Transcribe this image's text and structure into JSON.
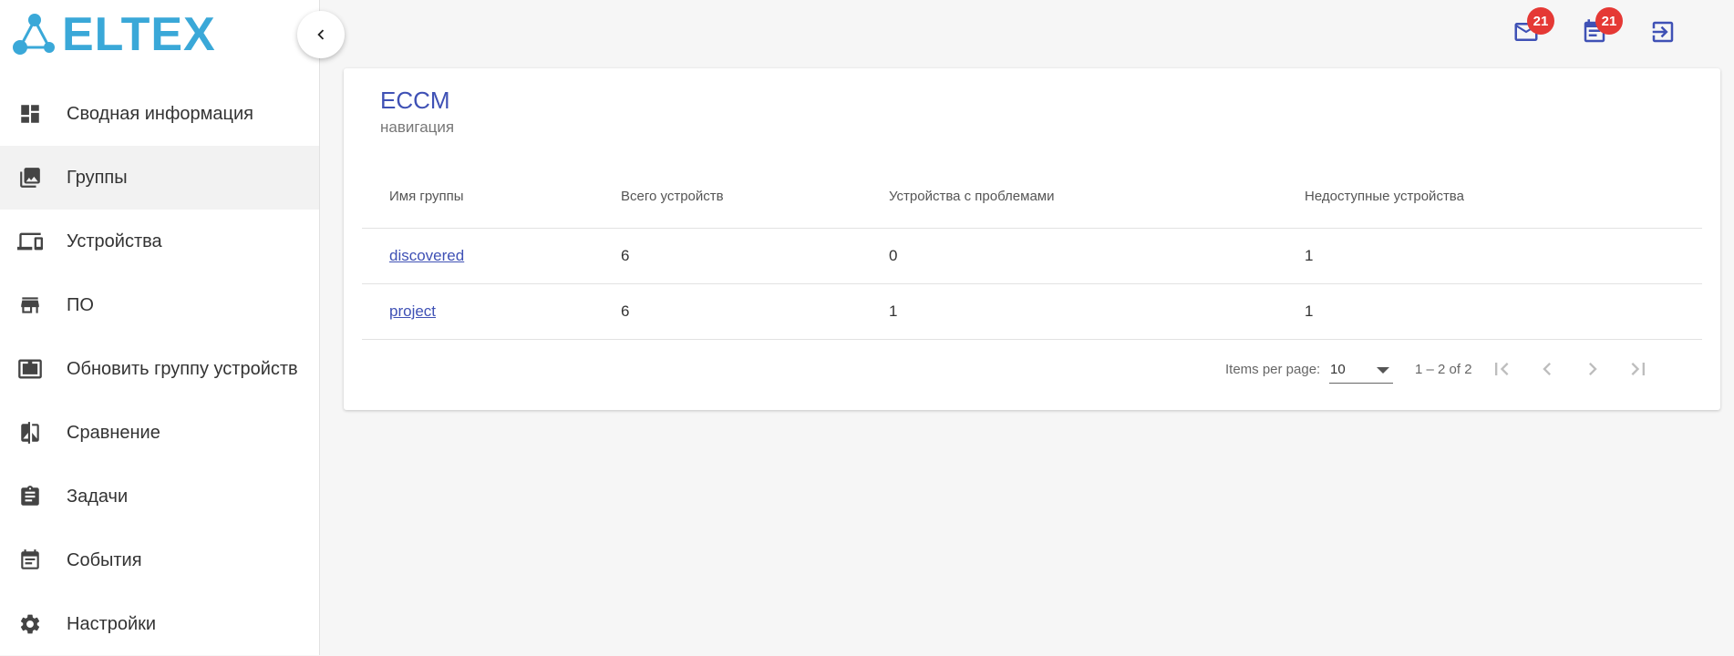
{
  "brand": {
    "logo_text": "ELTEX",
    "color": "#3aa8d8"
  },
  "sidebar": {
    "items": [
      {
        "label": "Сводная информация",
        "icon": "dashboard-icon",
        "active": false
      },
      {
        "label": "Группы",
        "icon": "photo-library-icon",
        "active": true
      },
      {
        "label": "Устройства",
        "icon": "devices-icon",
        "active": false
      },
      {
        "label": "ПО",
        "icon": "store-icon",
        "active": false
      },
      {
        "label": "Обновить группу устройств",
        "icon": "system-update-icon",
        "active": false
      },
      {
        "label": "Сравнение",
        "icon": "compare-icon",
        "active": false
      },
      {
        "label": "Задачи",
        "icon": "assignment-icon",
        "active": false
      },
      {
        "label": "События",
        "icon": "event-note-icon",
        "active": false
      },
      {
        "label": "Настройки",
        "icon": "settings-icon",
        "active": false
      }
    ]
  },
  "topbar": {
    "mail_badge": "21",
    "events_badge": "21",
    "accent_color": "#3f51b5",
    "badge_color": "#e53935"
  },
  "card": {
    "title": "ECCM",
    "subtitle": "навигация"
  },
  "table": {
    "headers": [
      "Имя группы",
      "Всего устройств",
      "Устройства с проблемами",
      "Недоступные устройства"
    ],
    "rows": [
      {
        "name": "discovered",
        "total": "6",
        "problems": "0",
        "unavailable": "1"
      },
      {
        "name": "project",
        "total": "6",
        "problems": "1",
        "unavailable": "1"
      }
    ]
  },
  "paginator": {
    "items_per_page_label": "Items per page:",
    "items_per_page_value": "10",
    "range_label": "1 – 2 of 2"
  }
}
